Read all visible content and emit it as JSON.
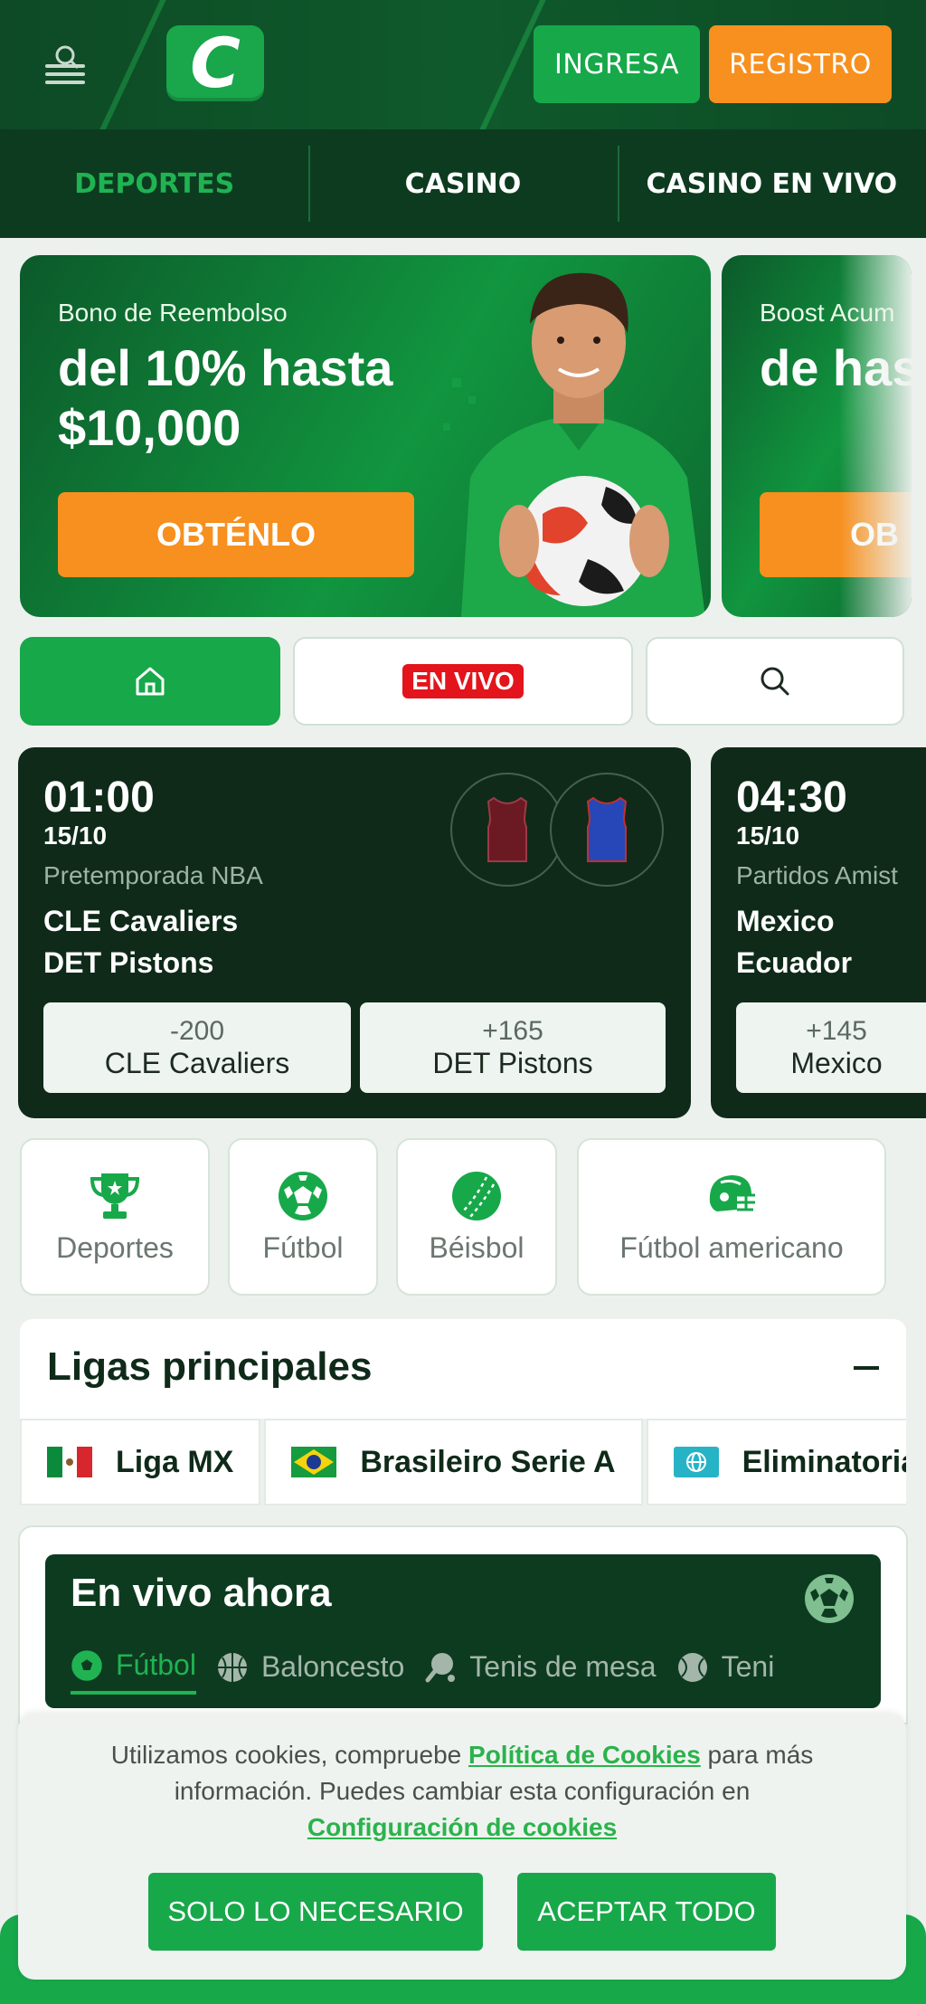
{
  "header": {
    "logo_letter": "C",
    "login_label": "INGRESA",
    "register_label": "REGISTRO"
  },
  "nav": {
    "tabs": [
      {
        "label": "DEPORTES",
        "active": true
      },
      {
        "label": "CASINO",
        "active": false
      },
      {
        "label": "CASINO EN VIVO",
        "active": false
      }
    ]
  },
  "promos": [
    {
      "subtitle": "Bono de Reembolso",
      "headline": "del 10% hasta $10,000",
      "cta": "OBTÉNLO"
    },
    {
      "subtitle": "Boost Acum",
      "headline": "de has",
      "cta": "OB"
    }
  ],
  "quick_filters": {
    "live_label": "EN VIVO"
  },
  "matches": [
    {
      "time": "01:00",
      "date": "15/10",
      "league": "Pretemporada NBA",
      "team1": "CLE Cavaliers",
      "team2": "DET Pistons",
      "odds": [
        {
          "price": "-200",
          "name": "CLE Cavaliers"
        },
        {
          "price": "+165",
          "name": "DET Pistons"
        }
      ]
    },
    {
      "time": "04:30",
      "date": "15/10",
      "league": "Partidos Amist",
      "team1": "Mexico",
      "team2": "Ecuador",
      "odds": [
        {
          "price": "+145",
          "name": "Mexico"
        }
      ]
    }
  ],
  "sports": [
    {
      "label": "Deportes",
      "icon": "trophy-icon"
    },
    {
      "label": "Fútbol",
      "icon": "soccer-ball-icon"
    },
    {
      "label": "Béisbol",
      "icon": "baseball-icon"
    },
    {
      "label": "Fútbol americano",
      "icon": "football-helmet-icon"
    }
  ],
  "top_leagues": {
    "title": "Ligas principales",
    "items": [
      {
        "name": "Liga MX",
        "flag": "mexico-flag-icon"
      },
      {
        "name": "Brasileiro Serie A",
        "flag": "brazil-flag-icon"
      },
      {
        "name": "Eliminatorias",
        "flag": "globe-icon"
      }
    ]
  },
  "live_now": {
    "title": "En vivo ahora",
    "tabs": [
      {
        "label": "Fútbol",
        "active": true
      },
      {
        "label": "Baloncesto",
        "active": false
      },
      {
        "label": "Tenis de mesa",
        "active": false
      },
      {
        "label": "Teni",
        "active": false
      }
    ]
  },
  "cookies": {
    "text_before": "Utilizamos cookies, compruebe ",
    "policy_link": "Política de Cookies",
    "text_middle": " para más información. Puedes cambiar esta configuración en ",
    "settings_link": "Configuración de cookies",
    "necessary_label": "SOLO LO NECESARIO",
    "accept_label": "ACEPTAR TODO"
  },
  "colors": {
    "brand_green": "#17a84a",
    "dark_green": "#0d3b20",
    "orange": "#f7901e",
    "live_red": "#e3141b"
  }
}
